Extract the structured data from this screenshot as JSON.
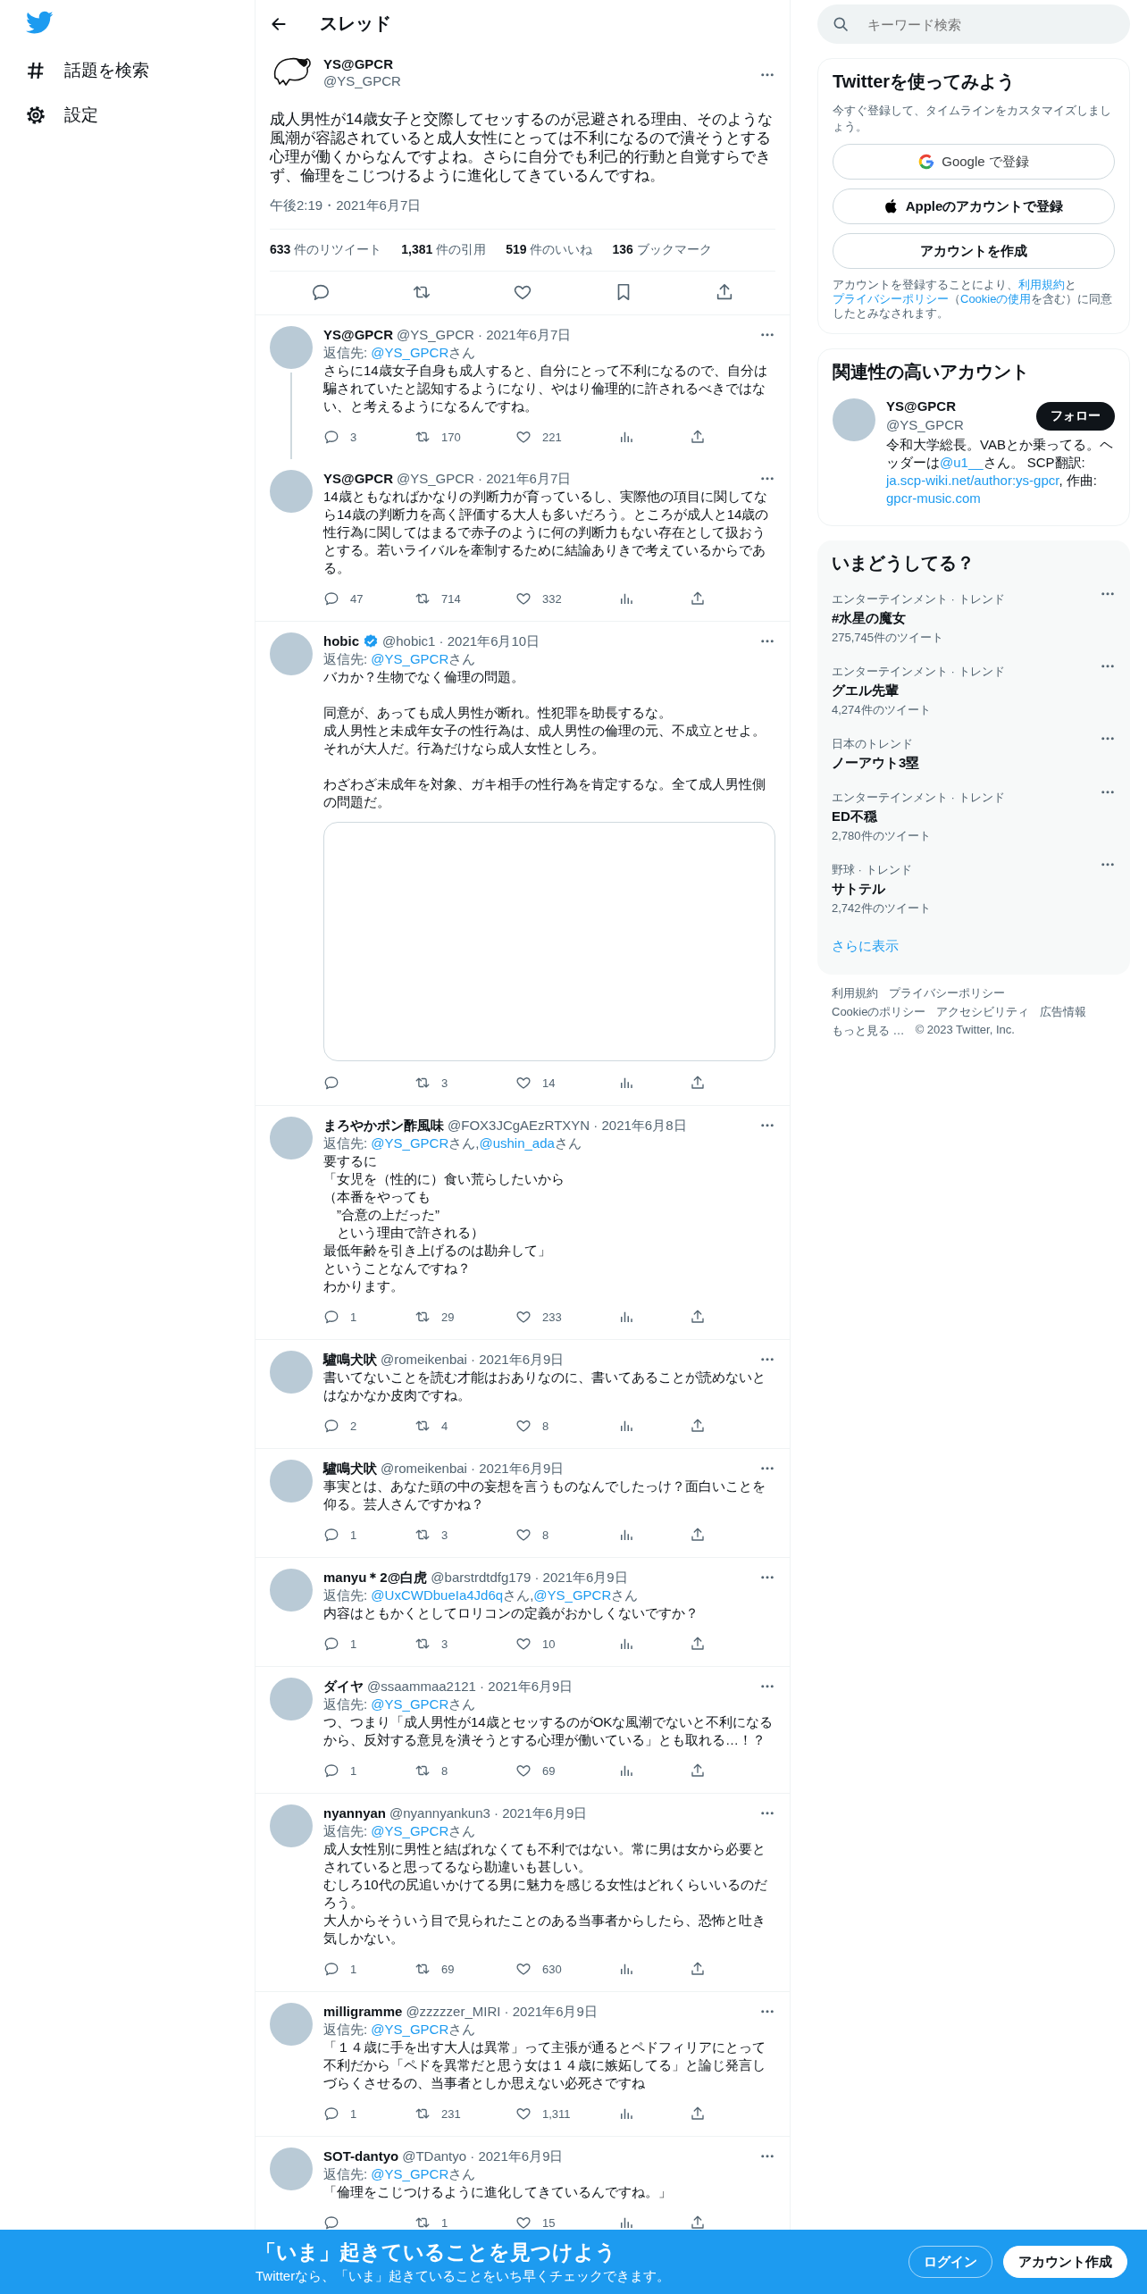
{
  "nav": [
    {
      "kind": "explore",
      "label": "話題を検索"
    },
    {
      "kind": "settings",
      "label": "設定"
    }
  ],
  "header": {
    "title": "スレッド"
  },
  "main_tweet": {
    "name": "YS@GPCR",
    "handle": "@YS_GPCR",
    "text": "成人男性が14歳女子と交際してセッするのが忌避される理由、そのような風潮が容認されていると成人女性にとっては不利になるので潰そうとする心理が働くからなんですよね。さらに自分でも利己的行動と自覚すらできず、倫理をこじつけるように進化してきているんですね。",
    "timestamp": "午後2:19・2021年6月7日",
    "stats": [
      {
        "count": "633",
        "label": "件のリツイート"
      },
      {
        "count": "1,381",
        "label": "件の引用"
      },
      {
        "count": "519",
        "label": "件のいいね"
      },
      {
        "count": "136",
        "label": "ブックマーク"
      }
    ]
  },
  "replies": [
    {
      "name": "YS@GPCR",
      "verified": false,
      "byline": "@YS_GPCR · 2021年6月7日",
      "reply_label": "返信先:",
      "reply_to": [
        {
          "handle": "@YS_GPCR",
          "suffix": "さん"
        }
      ],
      "paragraphs": [
        [
          "さらに14歳女子自身も成人すると、自分にとって不利になるので、自分は騙されていたと認知するようになり、やはり倫理的に許されるべきではない、と考えるようになるんですね。"
        ]
      ],
      "connected": true,
      "counts": {
        "replies": "3",
        "retweets": "170",
        "likes": "221"
      }
    },
    {
      "name": "YS@GPCR",
      "verified": false,
      "byline": "@YS_GPCR · 2021年6月7日",
      "paragraphs": [
        [
          "14歳ともなればかなりの判断力が育っているし、実際他の項目に関してなら14歳の判断力を高く評価する大人も多いだろう。ところが成人と14歳の性行為に関してはまるで赤子のように何の判断力もない存在として扱おうとする。若いライバルを牽制するために結論ありきで考えているからである。"
        ]
      ],
      "connected": false,
      "counts": {
        "replies": "47",
        "retweets": "714",
        "likes": "332"
      }
    },
    {
      "name": "hobic",
      "verified": true,
      "byline": "@hobic1 · 2021年6月10日",
      "reply_label": "返信先:",
      "reply_to": [
        {
          "handle": "@YS_GPCR",
          "suffix": "さん"
        }
      ],
      "paragraphs": [
        [
          "バカか？生物でなく倫理の問題。"
        ],
        [
          "同意が、あっても成人男性が断れ。性犯罪を助長するな。",
          "成人男性と未成年女子の性行為は、成人男性の倫理の元、不成立とせよ。",
          "それが大人だ。行為だけなら成人女性としろ。"
        ],
        [
          "わざわざ未成年を対象、ガキ相手の性行為を肯定するな。全て成人男性側の問題だ。"
        ]
      ],
      "media": {
        "kind": "blank"
      },
      "connected": false,
      "counts": {
        "retweets": "3",
        "likes": "14"
      }
    },
    {
      "name": "まろやかポン酢風味",
      "verified": false,
      "byline": "@FOX3JCgAEzRTXYN · 2021年6月8日",
      "reply_label": "返信先:",
      "reply_to": [
        {
          "handle": "@YS_GPCR",
          "suffix": "さん,"
        },
        {
          "handle": "@ushin_ada",
          "suffix": "さん"
        }
      ],
      "paragraphs": [
        [
          "要するに",
          "「女児を（性的に）食い荒らしたいから",
          "（本番をやっても",
          "　”合意の上だった”",
          "　という理由で許される）",
          "最低年齢を引き上げるのは勘弁して」",
          "ということなんですね？",
          "わかります。"
        ]
      ],
      "connected": false,
      "counts": {
        "replies": "1",
        "retweets": "29",
        "likes": "233"
      }
    },
    {
      "name": "驢鳴犬吠",
      "verified": false,
      "byline": "@romeikenbai · 2021年6月9日",
      "paragraphs": [
        [
          "書いてないことを読む才能はおありなのに、書いてあることが読めないとはなかなか皮肉ですね。"
        ]
      ],
      "connected": false,
      "counts": {
        "replies": "2",
        "retweets": "4",
        "likes": "8"
      }
    },
    {
      "name": "驢鳴犬吠",
      "verified": false,
      "byline": "@romeikenbai · 2021年6月9日",
      "paragraphs": [
        [
          "事実とは、あなた頭の中の妄想を言うものなんでしたっけ？面白いことを仰る。芸人さんですかね？"
        ]
      ],
      "connected": false,
      "counts": {
        "replies": "1",
        "retweets": "3",
        "likes": "8"
      }
    },
    {
      "name": "manyu＊2@白虎",
      "verified": false,
      "byline": "@barstrdtdfg179 · 2021年6月9日",
      "reply_label": "返信先:",
      "reply_to": [
        {
          "handle": "@UxCWDbueIa4Jd6q",
          "suffix": "さん,"
        },
        {
          "handle": "@YS_GPCR",
          "suffix": "さん"
        }
      ],
      "paragraphs": [
        [
          "内容はともかくとしてロリコンの定義がおかしくないですか？"
        ]
      ],
      "connected": false,
      "counts": {
        "replies": "1",
        "retweets": "3",
        "likes": "10"
      }
    },
    {
      "name": "ダイヤ",
      "verified": false,
      "byline": "@ssaammaa2121 · 2021年6月9日",
      "reply_label": "返信先:",
      "reply_to": [
        {
          "handle": "@YS_GPCR",
          "suffix": "さん"
        }
      ],
      "paragraphs": [
        [
          "つ、つまり「成人男性が14歳とセッするのがOKな風潮でないと不利になるから、反対する意見を潰そうとする心理が働いている」とも取れる…！？"
        ]
      ],
      "connected": false,
      "counts": {
        "replies": "1",
        "retweets": "8",
        "likes": "69"
      }
    },
    {
      "name": "nyannyan",
      "verified": false,
      "byline": "@nyannyankun3 · 2021年6月9日",
      "reply_label": "返信先:",
      "reply_to": [
        {
          "handle": "@YS_GPCR",
          "suffix": "さん"
        }
      ],
      "paragraphs": [
        [
          "成人女性別に男性と結ばれなくても不利ではない。常に男は女から必要とされていると思ってるなら勘違いも甚しい。",
          "むしろ10代の尻追いかけてる男に魅力を感じる女性はどれくらいいるのだろう。",
          "大人からそういう目で見られたことのある当事者からしたら、恐怖と吐き気しかない。"
        ]
      ],
      "connected": false,
      "counts": {
        "replies": "1",
        "retweets": "69",
        "likes": "630"
      }
    },
    {
      "name": "milligramme",
      "verified": false,
      "byline": "@zzzzzer_MIRI · 2021年6月9日",
      "reply_label": "返信先:",
      "reply_to": [
        {
          "handle": "@YS_GPCR",
          "suffix": "さん"
        }
      ],
      "paragraphs": [
        [
          "「１４歳に手を出す大人は異常」って主張が通るとペドフィリアにとって不利だから「ペドを異常だと思う女は１４歳に嫉妬してる」と論じ発言しづらくさせるの、当事者としか思えない必死さですね"
        ]
      ],
      "connected": false,
      "counts": {
        "replies": "1",
        "retweets": "231",
        "likes": "1,311"
      }
    },
    {
      "name": "SOT-dantyo",
      "verified": false,
      "byline": "@TDantyo · 2021年6月9日",
      "reply_label": "返信先:",
      "reply_to": [
        {
          "handle": "@YS_GPCR",
          "suffix": "さん"
        }
      ],
      "paragraphs": [
        [
          "「倫理をこじつけるように進化してきているんですね。」"
        ]
      ],
      "connected": false,
      "counts": {
        "retweets": "1",
        "likes": "15"
      }
    }
  ],
  "sidebar": {
    "search": {
      "placeholder": "キーワード検索"
    },
    "signup": {
      "title": "Twitterを使ってみよう",
      "subtitle": "今すぐ登録して、タイムラインをカスタマイズしましょう。",
      "buttons": [
        {
          "kind": "google",
          "label": "Google で登録"
        },
        {
          "kind": "apple",
          "label": "Appleのアカウントで登録"
        },
        {
          "kind": "plain",
          "label": "アカウントを作成"
        }
      ],
      "terms": [
        {
          "text": "アカウントを登録することにより、",
          "kind": "text"
        },
        {
          "text": "利用規約",
          "kind": "link"
        },
        {
          "text": "と",
          "kind": "text"
        },
        {
          "text": "プライバシーポリシー",
          "kind": "link"
        },
        {
          "text": "（",
          "kind": "text"
        },
        {
          "text": "Cookieの使用",
          "kind": "link"
        },
        {
          "text": "を含む）に同意したとみなされます。",
          "kind": "text"
        }
      ]
    },
    "related": {
      "title": "関連性の高いアカウント",
      "accounts": [
        {
          "name": "YS@GPCR",
          "handle": "@YS_GPCR",
          "button": "フォロー",
          "bio": [
            {
              "text": "令和大学総長。VABとか乗ってる。ヘッダーは",
              "kind": "text"
            },
            {
              "text": "@u1__",
              "kind": "link"
            },
            {
              "text": "さん。 SCP翻訳: ",
              "kind": "text"
            },
            {
              "text": "ja.scp-wiki.net/author:ys-gpcr",
              "kind": "link"
            },
            {
              "text": ", 作曲: ",
              "kind": "text"
            },
            {
              "text": "gpcr-music.com",
              "kind": "link"
            }
          ]
        }
      ]
    },
    "trends": {
      "title": "いまどうしてる？",
      "items": [
        {
          "context": "エンターテインメント · トレンド",
          "topic": "#水星の魔女",
          "count": "275,745件のツイート"
        },
        {
          "context": "エンターテインメント · トレンド",
          "topic": "グエル先輩",
          "count": "4,274件のツイート"
        },
        {
          "context": "日本のトレンド",
          "topic": "ノーアウト3塁"
        },
        {
          "context": "エンターテインメント · トレンド",
          "topic": "ED不穏",
          "count": "2,780件のツイート"
        },
        {
          "context": "野球 · トレンド",
          "topic": "サトテル",
          "count": "2,742件のツイート"
        }
      ],
      "more": "さらに表示"
    },
    "footer": [
      [
        "利用規約",
        "プライバシーポリシー"
      ],
      [
        "Cookieのポリシー",
        "アクセシビリティ",
        "広告情報"
      ],
      [
        "もっと見る …",
        "© 2023 Twitter, Inc."
      ]
    ]
  },
  "banner": {
    "title": "「いま」起きていることを見つけよう",
    "subtitle": "Twitterなら、「いま」起きていることをいち早くチェックできます。",
    "buttons": [
      {
        "kind": "outline",
        "label": "ログイン"
      },
      {
        "kind": "filled",
        "label": "アカウント作成"
      }
    ]
  }
}
